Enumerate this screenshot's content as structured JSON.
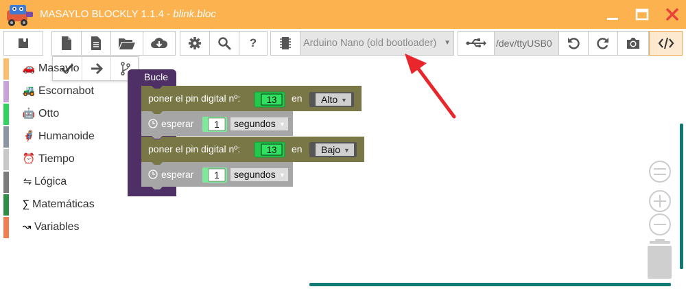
{
  "window": {
    "title_app": "MASAYLO BLOCKLY 1.1.4 - ",
    "title_file": "blink.bloc",
    "titlebar_color": "#fbb24f"
  },
  "toolbar": {
    "board": "Arduino Nano (old bootloader)",
    "port": "/dev/ttyUSB0",
    "help_label": "?",
    "icons": [
      "puzzle-icon",
      "new-file-icon",
      "document-icon",
      "open-folder-icon",
      "cloud-download-icon",
      "gear-icon",
      "search-icon",
      "help-icon",
      "chip-icon",
      "usb-icon",
      "undo-icon",
      "redo-icon",
      "camera-icon",
      "code-icon"
    ]
  },
  "subtoolbar": {
    "icons": [
      "check-icon",
      "arrow-right-icon",
      "branch-icon"
    ]
  },
  "toolbox": {
    "categories": [
      {
        "label": "Masaylo",
        "color": "#fcbd6e",
        "icon": "🚗"
      },
      {
        "label": "Escornabot",
        "color": "#c8a2d8",
        "icon": "🚜"
      },
      {
        "label": "Otto",
        "color": "#2fd35d",
        "icon": "🤖"
      },
      {
        "label": "Humanoide",
        "color": "#8b95a1",
        "icon": "🦸"
      },
      {
        "label": "Tiempo",
        "color": "#c8c8c8",
        "icon": "⏰"
      },
      {
        "label": "Lógica",
        "color": "#7b7b7b",
        "icon": "⇋"
      },
      {
        "label": "Matemáticas",
        "color": "#2f8e45",
        "icon": "∑"
      },
      {
        "label": "Variables",
        "color": "#f08052",
        "icon": "↝"
      }
    ]
  },
  "workspace": {
    "loop_block": {
      "label": "Bucle",
      "color": "#4e2f66"
    },
    "blocks": [
      {
        "type": "digital_write",
        "label": "poner el pin digital nº:",
        "pin": "13",
        "connector": "en",
        "state": "Alto",
        "color": "#7a7746"
      },
      {
        "type": "wait",
        "label": "esperar",
        "value": "1",
        "unit": "segundos",
        "color": "#a6a6a6"
      },
      {
        "type": "digital_write",
        "label": "poner el pin digital nº:",
        "pin": "13",
        "connector": "en",
        "state": "Bajo",
        "color": "#7a7746"
      },
      {
        "type": "wait",
        "label": "esperar",
        "value": "1",
        "unit": "segundos",
        "color": "#a6a6a6"
      }
    ],
    "zoom_controls": [
      "reset-zoom-icon",
      "zoom-in-icon",
      "zoom-out-icon",
      "trash-icon"
    ],
    "annotation_color": "#e8262b"
  }
}
